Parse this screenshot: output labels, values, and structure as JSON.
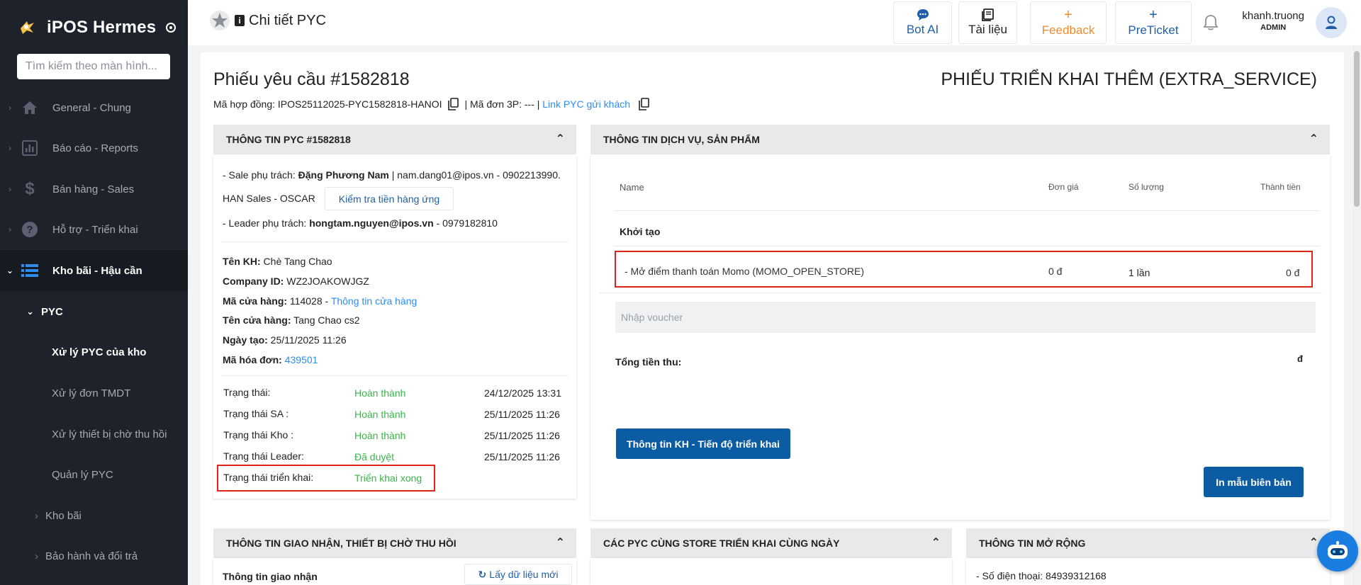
{
  "app": {
    "brand": "iPOS Hermes",
    "search_placeholder": "Tìm kiếm theo màn hình..."
  },
  "sidebar": {
    "items": [
      {
        "label": "General - Chung",
        "icon": "home-icon"
      },
      {
        "label": "Báo cáo - Reports",
        "icon": "chart-icon"
      },
      {
        "label": "Bán hàng - Sales",
        "icon": "dollar-icon"
      },
      {
        "label": "Hỗ trợ - Triển khai",
        "icon": "question-icon"
      },
      {
        "label": "Kho bãi - Hậu cần",
        "icon": "list-icon"
      }
    ],
    "sub_group": "PYC",
    "sub_items": [
      "Xử lý PYC của kho",
      "Xử lý đơn TMDT",
      "Xử lý thiết bị chờ thu hồi",
      "Quản lý PYC"
    ],
    "groups": [
      "Kho bãi",
      "Bảo hành và đổi trả"
    ]
  },
  "header": {
    "title": "Chi tiết PYC",
    "buttons": [
      {
        "label": "Bot AI",
        "icon": "chat-icon"
      },
      {
        "label": "Tài liệu",
        "icon": "book-icon"
      },
      {
        "label": "Feedback",
        "icon": "+"
      },
      {
        "label": "PreTicket",
        "icon": "+"
      }
    ],
    "user": {
      "name": "khanh.truong",
      "role": "ADMIN"
    }
  },
  "pyc": {
    "title": "Phiếu yêu cầu #1582818",
    "type": "PHIẾU TRIỂN KHAI THÊM (EXTRA_SERVICE)",
    "contract_label": "Mã hợp đồng: IPOS25112025-PYC1582818-HANOI",
    "order3p": " | Mã đơn 3P: --- | ",
    "link_label": "Link PYC gửi khách"
  },
  "info_card": {
    "header": "THÔNG TIN PYC #1582818",
    "sale_prefix": "- Sale phụ trách: ",
    "sale_name": "Đặng Phương Nam",
    "sale_rest": " | nam.dang01@ipos.vn - 0902213990.",
    "sale_team": "HAN Sales - OSCAR",
    "check_button": "Kiểm tra tiền hàng ứng",
    "leader_prefix": "- Leader phụ trách: ",
    "leader_name": "hongtam.nguyen@ipos.vn",
    "leader_rest": " - 0979182810",
    "fields": [
      {
        "label": "Tên KH:",
        "value": " Chè Tang Chao"
      },
      {
        "label": "Company ID:",
        "value": " WZ2JOAKOWJGZ"
      },
      {
        "label": "Mã cửa hàng:",
        "value": " 114028 - ",
        "link": "Thông tin cửa hàng"
      },
      {
        "label": "Tên cửa hàng:",
        "value": " Tang Chao cs2"
      },
      {
        "label": "Ngày tạo:",
        "value": " 25/11/2025 11:26"
      },
      {
        "label": "Mã hóa đơn:",
        "value": " ",
        "link": "439501"
      }
    ],
    "statuses": [
      {
        "label": "Trạng thái:",
        "value": "Hoàn thành",
        "time": "24/12/2025 13:31"
      },
      {
        "label": "Trạng thái SA :",
        "value": "Hoàn thành",
        "time": "25/11/2025 11:26"
      },
      {
        "label": "Trạng thái Kho :",
        "value": "Hoàn thành",
        "time": "25/11/2025 11:26"
      },
      {
        "label": "Trạng thái Leader:",
        "value": "Đã duyệt",
        "time": "25/11/2025 11:26"
      },
      {
        "label": "Trạng thái triển khai:",
        "value": "Triển khai xong",
        "time": ""
      }
    ]
  },
  "service_card": {
    "header": "THÔNG TIN DỊCH VỤ, SẢN PHẨM",
    "columns": [
      "Name",
      "Đơn giá",
      "Số lượng",
      "Thành tiền"
    ],
    "group": "Khởi tạo",
    "row": {
      "name": "- Mở điểm thanh toán Momo (MOMO_OPEN_STORE)",
      "price": "0 đ",
      "qty": "1 lần",
      "total": "0 đ"
    },
    "voucher_placeholder": "Nhập voucher",
    "total_label": "Tổng tiền thu:",
    "total_value": "đ",
    "progress_button": "Thông tin KH - Tiến độ triển khai",
    "print_button": "In mẫu biên bản"
  },
  "bottom_cards": {
    "delivery": {
      "header": "THÔNG TIN GIAO NHẬN, THIẾT BỊ CHỜ THU HỒI",
      "sub": "Thông tin giao nhận",
      "refresh": "Lấy dữ liệu mới"
    },
    "same_store": {
      "header": "CÁC PYC CÙNG STORE TRIỂN KHAI CÙNG NGÀY"
    },
    "extended": {
      "header": "THÔNG TIN MỞ RỘNG",
      "phone": "- Số điện thoại: 84939312168"
    }
  },
  "colors": {
    "sidebar": "#1d222b",
    "primary": "#0b5ca3",
    "success": "#3ab54a",
    "link": "#2d8ef0",
    "feedback": "#f08c2b",
    "highlight": "#e2231a"
  }
}
